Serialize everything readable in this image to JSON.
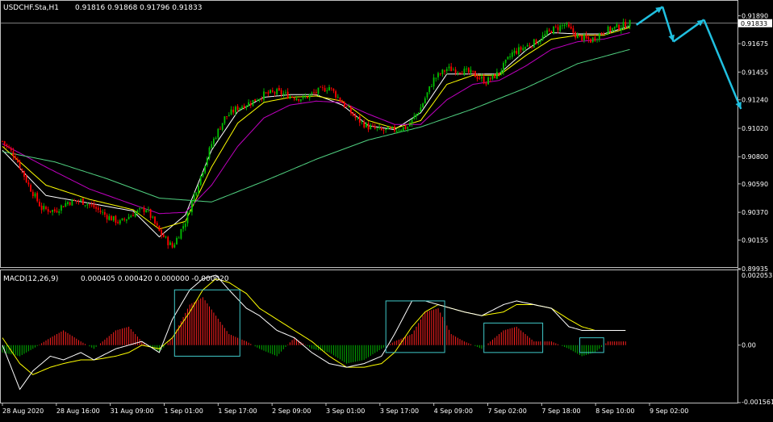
{
  "window": {
    "title": "USDCHF.Sta,H1",
    "ohlc": "0.91816 0.91868 0.91796 0.91833"
  },
  "colors": {
    "background": "#000000",
    "frame": "#c0c0c0",
    "text": "#ffffff",
    "bull": "#00c000",
    "bear": "#ff0000",
    "ma_fast": "#ffffff",
    "ma_mid": "#ffff00",
    "ma_slow": "#c000c0",
    "ma_long": "#50d080",
    "macd_pos": "#ff2020",
    "macd_neg": "#00b000",
    "signal": "#ffff00",
    "macd_line": "#ffffff",
    "boxes": "#40c8c8",
    "arrows": "#20c0e0",
    "price_line": "#b0b0b0"
  },
  "chart_data": [
    {
      "type": "candlestick",
      "title": "USDCHF.Sta,H1",
      "ohlc_label": "0.91816 0.91868 0.91796 0.91833",
      "current_price": 0.91833,
      "current_price_label": "0.91833",
      "y_ticks": [
        "0.91890",
        "0.91675",
        "0.91455",
        "0.91240",
        "0.91020",
        "0.90800",
        "0.90590",
        "0.90370",
        "0.90155",
        "0.89935"
      ],
      "ylim": [
        0.8994,
        0.92
      ],
      "x_ticks": [
        "28 Aug 2020",
        "28 Aug 16:00",
        "31 Aug 09:00",
        "1 Sep 01:00",
        "1 Sep 17:00",
        "2 Sep 09:00",
        "3 Sep 01:00",
        "3 Sep 17:00",
        "4 Sep 09:00",
        "7 Sep 02:00",
        "7 Sep 18:00",
        "8 Sep 10:00",
        "9 Sep 02:00"
      ],
      "close_path": [
        [
          0,
          0.9092
        ],
        [
          6,
          0.908
        ],
        [
          12,
          0.9058
        ],
        [
          18,
          0.904
        ],
        [
          24,
          0.9038
        ],
        [
          30,
          0.9045
        ],
        [
          36,
          0.9046
        ],
        [
          42,
          0.9041
        ],
        [
          48,
          0.9034
        ],
        [
          54,
          0.9029
        ],
        [
          60,
          0.9036
        ],
        [
          66,
          0.904
        ],
        [
          72,
          0.9022
        ],
        [
          78,
          0.901
        ],
        [
          84,
          0.903
        ],
        [
          90,
          0.906
        ],
        [
          96,
          0.909
        ],
        [
          102,
          0.911
        ],
        [
          108,
          0.9118
        ],
        [
          114,
          0.9122
        ],
        [
          120,
          0.9128
        ],
        [
          126,
          0.913
        ],
        [
          132,
          0.9127
        ],
        [
          138,
          0.9125
        ],
        [
          144,
          0.913
        ],
        [
          150,
          0.9134
        ],
        [
          156,
          0.9122
        ],
        [
          162,
          0.911
        ],
        [
          168,
          0.9103
        ],
        [
          174,
          0.91
        ],
        [
          180,
          0.9101
        ],
        [
          186,
          0.9103
        ],
        [
          192,
          0.9118
        ],
        [
          198,
          0.914
        ],
        [
          204,
          0.9148
        ],
        [
          210,
          0.9147
        ],
        [
          216,
          0.9144
        ],
        [
          222,
          0.9138
        ],
        [
          228,
          0.9145
        ],
        [
          234,
          0.916
        ],
        [
          240,
          0.9165
        ],
        [
          246,
          0.917
        ],
        [
          252,
          0.9178
        ],
        [
          258,
          0.9182
        ],
        [
          264,
          0.9173
        ],
        [
          270,
          0.917
        ],
        [
          276,
          0.9177
        ],
        [
          282,
          0.918
        ],
        [
          288,
          0.91833
        ]
      ],
      "moving_averages": [
        {
          "name": "ma_fast",
          "path": [
            [
              0,
              0.9085
            ],
            [
              20,
              0.905
            ],
            [
              40,
              0.9044
            ],
            [
              60,
              0.9038
            ],
            [
              72,
              0.9018
            ],
            [
              84,
              0.9035
            ],
            [
              96,
              0.9085
            ],
            [
              108,
              0.9115
            ],
            [
              120,
              0.9126
            ],
            [
              132,
              0.9128
            ],
            [
              144,
              0.9128
            ],
            [
              156,
              0.912
            ],
            [
              168,
              0.9104
            ],
            [
              180,
              0.9101
            ],
            [
              192,
              0.9114
            ],
            [
              204,
              0.9144
            ],
            [
              216,
              0.9144
            ],
            [
              228,
              0.9144
            ],
            [
              240,
              0.9162
            ],
            [
              252,
              0.9176
            ],
            [
              264,
              0.9175
            ],
            [
              276,
              0.9175
            ],
            [
              288,
              0.9181
            ]
          ]
        },
        {
          "name": "ma_mid",
          "path": [
            [
              0,
              0.9088
            ],
            [
              20,
              0.9058
            ],
            [
              40,
              0.9047
            ],
            [
              60,
              0.9039
            ],
            [
              72,
              0.9024
            ],
            [
              84,
              0.903
            ],
            [
              96,
              0.9072
            ],
            [
              108,
              0.9106
            ],
            [
              120,
              0.9122
            ],
            [
              132,
              0.9126
            ],
            [
              144,
              0.9127
            ],
            [
              156,
              0.9123
            ],
            [
              168,
              0.9108
            ],
            [
              180,
              0.9102
            ],
            [
              192,
              0.9108
            ],
            [
              204,
              0.9136
            ],
            [
              216,
              0.9143
            ],
            [
              228,
              0.9143
            ],
            [
              240,
              0.9158
            ],
            [
              252,
              0.9171
            ],
            [
              264,
              0.9174
            ],
            [
              276,
              0.9174
            ],
            [
              288,
              0.918
            ]
          ]
        },
        {
          "name": "ma_slow",
          "path": [
            [
              0,
              0.909
            ],
            [
              20,
              0.9072
            ],
            [
              40,
              0.9055
            ],
            [
              60,
              0.9043
            ],
            [
              72,
              0.9036
            ],
            [
              84,
              0.9037
            ],
            [
              96,
              0.9058
            ],
            [
              108,
              0.9088
            ],
            [
              120,
              0.911
            ],
            [
              132,
              0.912
            ],
            [
              144,
              0.9123
            ],
            [
              156,
              0.9122
            ],
            [
              168,
              0.9113
            ],
            [
              180,
              0.9105
            ],
            [
              192,
              0.9105
            ],
            [
              204,
              0.9124
            ],
            [
              216,
              0.9136
            ],
            [
              228,
              0.9139
            ],
            [
              240,
              0.915
            ],
            [
              252,
              0.9163
            ],
            [
              264,
              0.9169
            ],
            [
              276,
              0.9171
            ],
            [
              288,
              0.9176
            ]
          ]
        },
        {
          "name": "ma_long",
          "path": [
            [
              0,
              0.9084
            ],
            [
              24,
              0.9076
            ],
            [
              48,
              0.9063
            ],
            [
              72,
              0.9048
            ],
            [
              96,
              0.9045
            ],
            [
              120,
              0.9061
            ],
            [
              144,
              0.9078
            ],
            [
              168,
              0.9093
            ],
            [
              192,
              0.9103
            ],
            [
              216,
              0.9117
            ],
            [
              240,
              0.9133
            ],
            [
              264,
              0.9152
            ],
            [
              288,
              0.9163
            ]
          ]
        }
      ],
      "annotation_arrows": [
        {
          "from": [
            291,
            0.9182
          ],
          "to": [
            303,
            0.9196
          ]
        },
        {
          "from": [
            303,
            0.9196
          ],
          "to": [
            308,
            0.9169
          ]
        },
        {
          "from": [
            308,
            0.9169
          ],
          "to": [
            322,
            0.9186
          ]
        },
        {
          "from": [
            322,
            0.9186
          ],
          "to": [
            339,
            0.9117
          ]
        }
      ]
    },
    {
      "type": "bar",
      "title": "MACD(12,26,9)",
      "values_label": "0.000405 0.000420 0.000000 -0.000020",
      "y_ticks": [
        "0.002053",
        "0.00",
        "-0.001561"
      ],
      "ylim": [
        -0.001561,
        0.002053
      ],
      "histogram_path": [
        [
          0,
          -0.0002
        ],
        [
          8,
          -0.0003
        ],
        [
          14,
          -0.0001
        ],
        [
          22,
          0.0002
        ],
        [
          28,
          0.0004
        ],
        [
          36,
          0.0001
        ],
        [
          42,
          -0.0001
        ],
        [
          52,
          0.0004
        ],
        [
          58,
          0.0005
        ],
        [
          64,
          0.0001
        ],
        [
          72,
          -0.0002
        ],
        [
          78,
          0.0002
        ],
        [
          86,
          0.0011
        ],
        [
          92,
          0.0013
        ],
        [
          98,
          0.0008
        ],
        [
          104,
          0.0003
        ],
        [
          112,
          0.0001
        ],
        [
          118,
          -0.0001
        ],
        [
          126,
          -0.0003
        ],
        [
          134,
          0.0002
        ],
        [
          142,
          -0.0001
        ],
        [
          150,
          -0.0002
        ],
        [
          158,
          -0.0005
        ],
        [
          166,
          -0.0004
        ],
        [
          174,
          -0.0001
        ],
        [
          180,
          0.0001
        ],
        [
          188,
          0.0003
        ],
        [
          194,
          0.0009
        ],
        [
          200,
          0.001
        ],
        [
          206,
          0.0003
        ],
        [
          212,
          0.0001
        ],
        [
          220,
          -0.0001
        ],
        [
          230,
          0.0004
        ],
        [
          236,
          0.0005
        ],
        [
          244,
          0.0001
        ],
        [
          252,
          0.0001
        ],
        [
          260,
          -0.0001
        ],
        [
          266,
          -0.0003
        ],
        [
          272,
          -0.0002
        ],
        [
          278,
          0.0001
        ],
        [
          286,
          0.0001
        ]
      ],
      "macd_line_path": [
        [
          0,
          0.0
        ],
        [
          8,
          -0.0012
        ],
        [
          14,
          -0.0007
        ],
        [
          22,
          -0.0003
        ],
        [
          28,
          -0.0004
        ],
        [
          36,
          -0.0002
        ],
        [
          42,
          -0.0004
        ],
        [
          52,
          -0.0001
        ],
        [
          58,
          0.0
        ],
        [
          64,
          0.0001
        ],
        [
          72,
          -0.0002
        ],
        [
          78,
          0.0007
        ],
        [
          86,
          0.0015
        ],
        [
          92,
          0.0018
        ],
        [
          98,
          0.0019
        ],
        [
          104,
          0.0015
        ],
        [
          112,
          0.001
        ],
        [
          118,
          0.0008
        ],
        [
          126,
          0.0004
        ],
        [
          134,
          0.0002
        ],
        [
          142,
          -0.0002
        ],
        [
          150,
          -0.0005
        ],
        [
          158,
          -0.0006
        ],
        [
          166,
          -0.0005
        ],
        [
          174,
          -0.0003
        ],
        [
          180,
          0.0003
        ],
        [
          188,
          0.0012
        ],
        [
          194,
          0.0012
        ],
        [
          200,
          0.0011
        ],
        [
          206,
          0.001
        ],
        [
          212,
          0.0009
        ],
        [
          220,
          0.0008
        ],
        [
          230,
          0.0011
        ],
        [
          236,
          0.0012
        ],
        [
          244,
          0.0011
        ],
        [
          252,
          0.001
        ],
        [
          260,
          0.0005
        ],
        [
          266,
          0.0004
        ],
        [
          272,
          0.0004
        ],
        [
          278,
          0.0004
        ],
        [
          286,
          0.0004
        ]
      ],
      "signal_line_path": [
        [
          0,
          0.0002
        ],
        [
          8,
          -0.0005
        ],
        [
          14,
          -0.0008
        ],
        [
          22,
          -0.0006
        ],
        [
          28,
          -0.0005
        ],
        [
          36,
          -0.0004
        ],
        [
          42,
          -0.0004
        ],
        [
          52,
          -0.0003
        ],
        [
          58,
          -0.0002
        ],
        [
          64,
          0.0
        ],
        [
          72,
          -0.0001
        ],
        [
          78,
          0.0002
        ],
        [
          86,
          0.0009
        ],
        [
          92,
          0.0015
        ],
        [
          98,
          0.0018
        ],
        [
          104,
          0.0017
        ],
        [
          112,
          0.0014
        ],
        [
          118,
          0.001
        ],
        [
          126,
          0.0007
        ],
        [
          134,
          0.0004
        ],
        [
          142,
          0.0001
        ],
        [
          150,
          -0.0003
        ],
        [
          158,
          -0.0006
        ],
        [
          166,
          -0.0006
        ],
        [
          174,
          -0.0005
        ],
        [
          180,
          -0.0002
        ],
        [
          188,
          0.0005
        ],
        [
          194,
          0.0009
        ],
        [
          200,
          0.0011
        ],
        [
          206,
          0.001
        ],
        [
          212,
          0.0009
        ],
        [
          220,
          0.0008
        ],
        [
          230,
          0.0009
        ],
        [
          236,
          0.0011
        ],
        [
          244,
          0.0011
        ],
        [
          252,
          0.001
        ],
        [
          260,
          0.0007
        ],
        [
          266,
          0.0005
        ],
        [
          272,
          0.0004
        ],
        [
          278,
          0.0004
        ],
        [
          286,
          0.0004
        ]
      ],
      "highlight_boxes": [
        {
          "from": 79,
          "to": 109,
          "top": 0.0015,
          "bottom": -0.0003
        },
        {
          "from": 176,
          "to": 203,
          "top": 0.0012,
          "bottom": -0.0002
        },
        {
          "from": 221,
          "to": 248,
          "top": 0.0006,
          "bottom": -0.0002
        },
        {
          "from": 265,
          "to": 276,
          "top": 0.0002,
          "bottom": -0.0002
        }
      ]
    }
  ]
}
